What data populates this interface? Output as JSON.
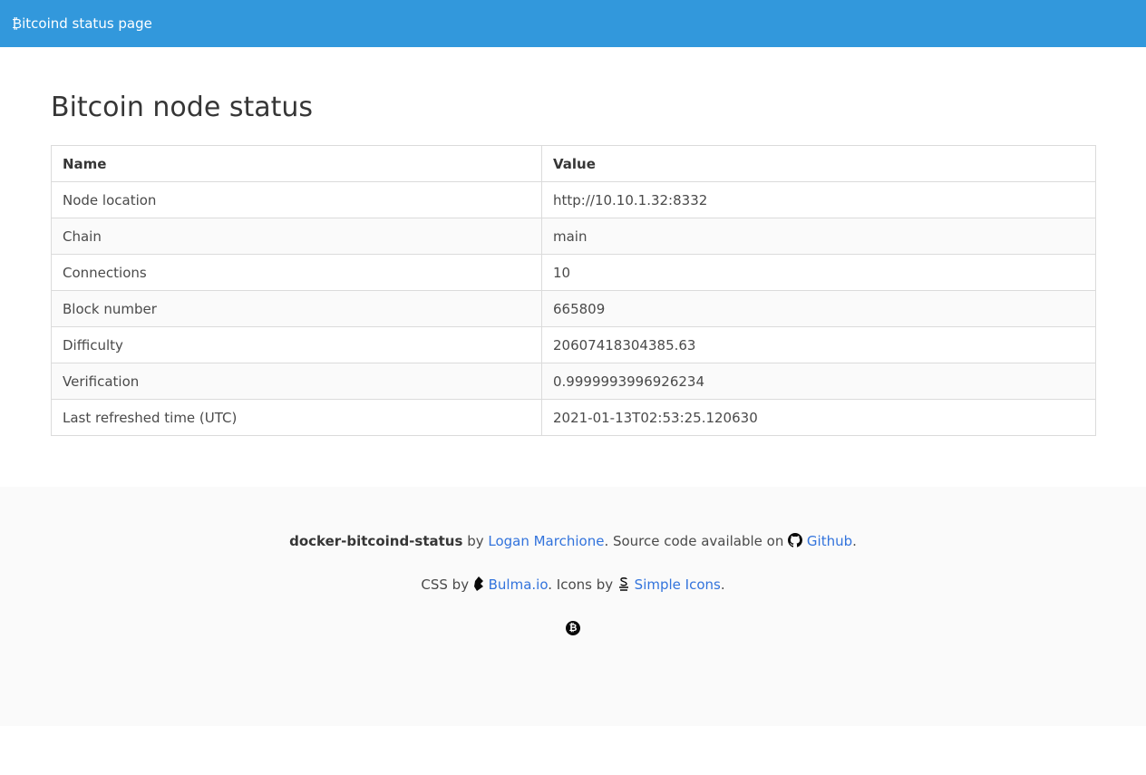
{
  "navbar": {
    "brand_glyph": "₿",
    "brand_text": "itcoind status page"
  },
  "page": {
    "title": "Bitcoin node status"
  },
  "table": {
    "headers": [
      "Name",
      "Value"
    ],
    "rows": [
      {
        "name": "Node location",
        "value": "http://10.10.1.32:8332"
      },
      {
        "name": "Chain",
        "value": "main"
      },
      {
        "name": "Connections",
        "value": "10"
      },
      {
        "name": "Block number",
        "value": "665809"
      },
      {
        "name": "Difficulty",
        "value": "20607418304385.63"
      },
      {
        "name": "Verification",
        "value": "0.9999993996926234"
      },
      {
        "name": "Last refreshed time (UTC)",
        "value": "2021-01-13T02:53:25.120630"
      }
    ]
  },
  "footer": {
    "project": "docker-bitcoind-status",
    "by": " by ",
    "author": "Logan Marchione",
    "source_text": ". Source code available on ",
    "github": "Github",
    "period1": ".",
    "css_by": "CSS by ",
    "bulma": "Bulma.io",
    "icons_by": ". Icons by ",
    "simple_icons": "Simple Icons",
    "period2": ".",
    "coin_glyph": "₿",
    "icons": [
      "github-icon",
      "bulma-icon",
      "simple-icons-icon",
      "bitcoin-icon"
    ]
  },
  "colors": {
    "navbar": "#3298dc",
    "link": "#3273dc",
    "footer_bg": "#fafafa"
  }
}
